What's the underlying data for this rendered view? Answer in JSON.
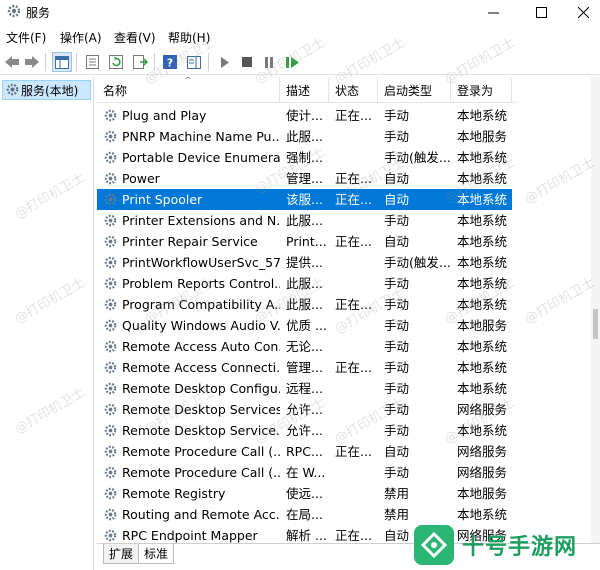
{
  "window": {
    "title": "服务"
  },
  "menu": [
    "文件(F)",
    "操作(A)",
    "查看(V)",
    "帮助(H)"
  ],
  "tree": {
    "item_label": "服务(本地)"
  },
  "columns": {
    "name": "名称",
    "desc": "描述",
    "status": "状态",
    "startup": "启动类型",
    "logon": "登录为"
  },
  "rows": [
    {
      "name": "Plug and Play",
      "desc": "使计...",
      "status": "正在...",
      "startup": "手动",
      "logon": "本地系统"
    },
    {
      "name": "PNRP Machine Name Pu...",
      "desc": "此服...",
      "status": "",
      "startup": "手动",
      "logon": "本地服务"
    },
    {
      "name": "Portable Device Enumera...",
      "desc": "强制...",
      "status": "",
      "startup": "手动(触发...",
      "logon": "本地系统"
    },
    {
      "name": "Power",
      "desc": "管理...",
      "status": "正在...",
      "startup": "自动",
      "logon": "本地系统"
    },
    {
      "name": "Print Spooler",
      "desc": "该服...",
      "status": "正在...",
      "startup": "自动",
      "logon": "本地系统"
    },
    {
      "name": "Printer Extensions and N...",
      "desc": "此服...",
      "status": "",
      "startup": "手动",
      "logon": "本地系统"
    },
    {
      "name": "Printer Repair Service",
      "desc": "Print...",
      "status": "正在...",
      "startup": "自动",
      "logon": "本地系统"
    },
    {
      "name": "PrintWorkflowUserSvc_57...",
      "desc": "提供...",
      "status": "",
      "startup": "手动(触发...",
      "logon": "本地系统"
    },
    {
      "name": "Problem Reports Control...",
      "desc": "此服...",
      "status": "",
      "startup": "手动",
      "logon": "本地系统"
    },
    {
      "name": "Program Compatibility A...",
      "desc": "此服...",
      "status": "正在...",
      "startup": "手动",
      "logon": "本地系统"
    },
    {
      "name": "Quality Windows Audio V...",
      "desc": "优质 ...",
      "status": "",
      "startup": "手动",
      "logon": "本地服务"
    },
    {
      "name": "Remote Access Auto Con...",
      "desc": "无论...",
      "status": "",
      "startup": "手动",
      "logon": "本地系统"
    },
    {
      "name": "Remote Access Connecti...",
      "desc": "管理...",
      "status": "正在...",
      "startup": "手动",
      "logon": "本地系统"
    },
    {
      "name": "Remote Desktop Configu...",
      "desc": "远程...",
      "status": "",
      "startup": "手动",
      "logon": "本地系统"
    },
    {
      "name": "Remote Desktop Services",
      "desc": "允许...",
      "status": "",
      "startup": "手动",
      "logon": "网络服务"
    },
    {
      "name": "Remote Desktop Service...",
      "desc": "允许...",
      "status": "",
      "startup": "手动",
      "logon": "本地系统"
    },
    {
      "name": "Remote Procedure Call (...",
      "desc": "RPC...",
      "status": "正在...",
      "startup": "自动",
      "logon": "网络服务"
    },
    {
      "name": "Remote Procedure Call (...",
      "desc": "在 W...",
      "status": "",
      "startup": "手动",
      "logon": "网络服务"
    },
    {
      "name": "Remote Registry",
      "desc": "使远...",
      "status": "",
      "startup": "禁用",
      "logon": "本地服务"
    },
    {
      "name": "Routing and Remote Acc...",
      "desc": "在局...",
      "status": "",
      "startup": "禁用",
      "logon": "本地系统"
    },
    {
      "name": "RPC Endpoint Mapper",
      "desc": "解析 ...",
      "status": "正在...",
      "startup": "自动",
      "logon": "网络服务"
    }
  ],
  "selected_row": "Print Spooler",
  "tabs": [
    "扩展",
    "标准"
  ],
  "active_tab": "标准",
  "watermark": "@打印机卫士",
  "brand": {
    "text": "十号手游网"
  },
  "colors": {
    "selection": "#0078d7",
    "brand": "#2bb673"
  }
}
